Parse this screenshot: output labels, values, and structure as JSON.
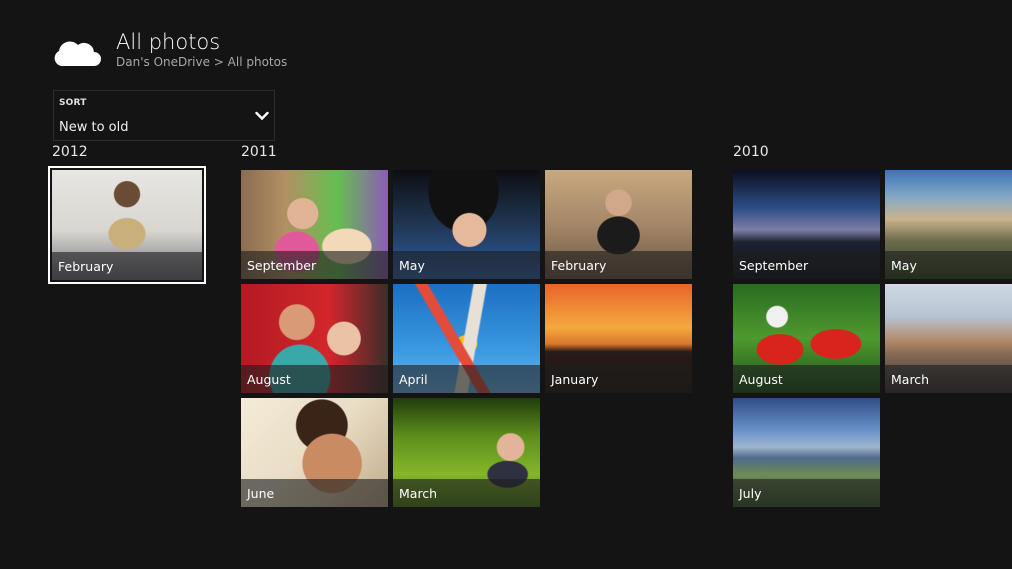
{
  "header": {
    "app_icon": "onedrive-cloud-icon",
    "title": "All photos",
    "breadcrumb": "Dan's OneDrive > All photos"
  },
  "sort": {
    "label": "SORT",
    "value": "New to old",
    "icon": "chevron-down-icon"
  },
  "groups": [
    {
      "year": "2012",
      "tiles": [
        {
          "label": "February",
          "selected": true
        }
      ]
    },
    {
      "year": "2011",
      "tiles": [
        {
          "label": "September"
        },
        {
          "label": "May"
        },
        {
          "label": "February"
        },
        {
          "label": "August"
        },
        {
          "label": "April"
        },
        {
          "label": "January"
        },
        {
          "label": "June"
        },
        {
          "label": "March"
        }
      ]
    },
    {
      "year": "2010",
      "tiles": [
        {
          "label": "September"
        },
        {
          "label": "May"
        },
        {
          "label": "August"
        },
        {
          "label": "March"
        },
        {
          "label": "July"
        }
      ]
    }
  ]
}
